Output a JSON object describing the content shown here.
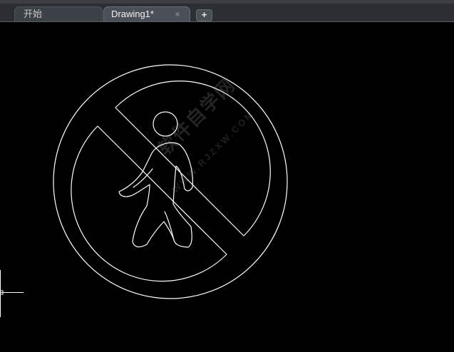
{
  "tabs": [
    {
      "label": "开始"
    },
    {
      "label": "Drawing1*",
      "close": "×"
    }
  ],
  "new_tab_label": "+",
  "watermark": {
    "text": "软件自学网",
    "sub": "WWW.RJZXW.COM"
  },
  "colors": {
    "canvas": "#000000",
    "lines": "#ffffff",
    "tabbar": "#2b2f34"
  }
}
